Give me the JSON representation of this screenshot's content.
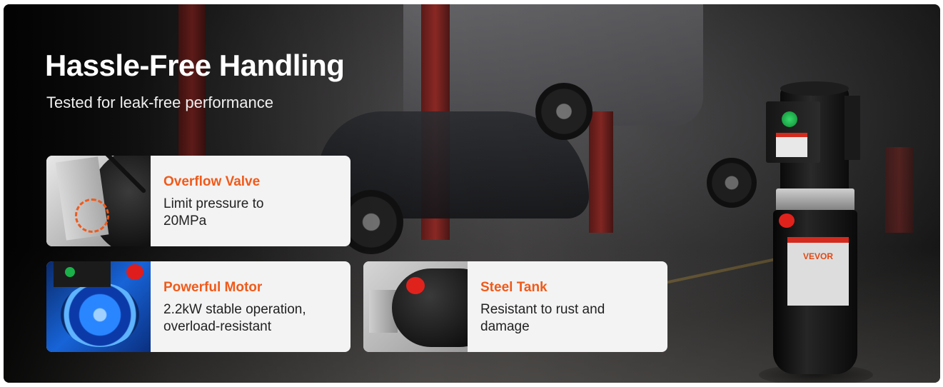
{
  "title": "Hassle-Free Handling",
  "subtitle": "Tested for leak-free performance",
  "features": [
    {
      "heading": "Overflow Valve",
      "line1": "Limit pressure to",
      "line2": "20MPa",
      "icon": "overflow-valve-photo"
    },
    {
      "heading": "Powerful Motor",
      "line1": "2.2kW stable operation,",
      "line2": "overload-resistant",
      "icon": "motor-photo"
    },
    {
      "heading": "Steel Tank",
      "line1": "Resistant to rust and",
      "line2": "damage",
      "icon": "steel-tank-photo"
    }
  ],
  "product": {
    "brand": "VEVOR"
  },
  "colors": {
    "accent": "#f05a1a",
    "card": "#f3f3f3",
    "background": "#2b2a2a",
    "title": "#ffffff"
  }
}
